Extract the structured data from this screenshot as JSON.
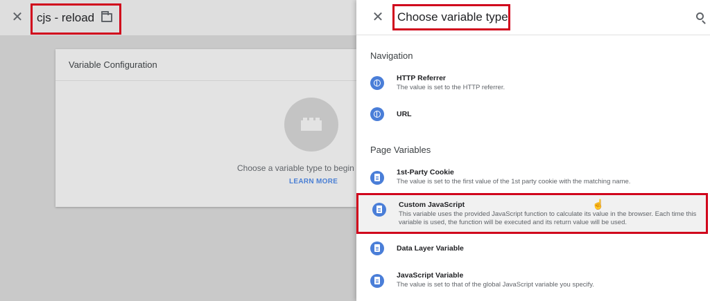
{
  "left": {
    "close_glyph": "✕",
    "title": "cjs - reload",
    "config_title": "Variable Configuration",
    "choose_text": "Choose a variable type to begin",
    "learn_more": "LEARN MORE"
  },
  "panel": {
    "close_glyph": "✕",
    "title": "Choose variable type",
    "sections": [
      {
        "label": "Navigation",
        "items": [
          {
            "name": "HTTP Referrer",
            "desc": "The value is set to the HTTP referrer.",
            "icon": "globe-icon"
          },
          {
            "name": "URL",
            "desc": "",
            "icon": "globe-icon"
          }
        ]
      },
      {
        "label": "Page Variables",
        "items": [
          {
            "name": "1st-Party Cookie",
            "desc": "The value is set to the first value of the 1st party cookie with the matching name.",
            "icon": "document-icon"
          },
          {
            "name": "Custom JavaScript",
            "desc": "This variable uses the provided JavaScript function to calculate its value in the browser. Each time this variable is used, the function will be executed and its return value will be used.",
            "icon": "document-icon"
          },
          {
            "name": "Data Layer Variable",
            "desc": "",
            "icon": "document-icon"
          },
          {
            "name": "JavaScript Variable",
            "desc": "The value is set to that of the global JavaScript variable you specify.",
            "icon": "document-icon"
          }
        ]
      }
    ]
  },
  "colors": {
    "accent": "#4a7ed8",
    "highlight_border": "#d0021b",
    "link": "#4a7fd4"
  }
}
